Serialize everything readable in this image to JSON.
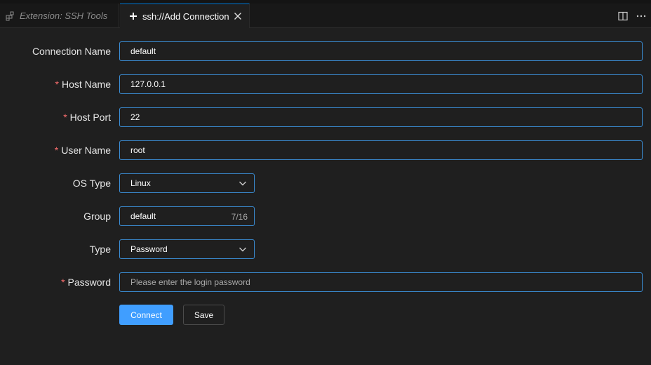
{
  "tabs": {
    "inactive_label": "Extension: SSH Tools",
    "active_label": "ssh://Add Connection"
  },
  "form": {
    "connection_name": {
      "label": "Connection Name",
      "value": "default"
    },
    "host_name": {
      "required_mark": "*",
      "label": "Host Name",
      "value": "127.0.0.1"
    },
    "host_port": {
      "required_mark": "*",
      "label": "Host Port",
      "value": "22"
    },
    "user_name": {
      "required_mark": "*",
      "label": "User Name",
      "value": "root"
    },
    "os_type": {
      "label": "OS Type",
      "value": "Linux"
    },
    "group": {
      "label": "Group",
      "value": "default",
      "count": "7/16"
    },
    "type": {
      "label": "Type",
      "value": "Password"
    },
    "password": {
      "required_mark": "*",
      "label": "Password",
      "placeholder": "Please enter the login password"
    }
  },
  "buttons": {
    "connect": "Connect",
    "save": "Save"
  },
  "colors": {
    "accent": "#409eff",
    "border": "#3b8ed6",
    "required": "#f56c6c"
  }
}
